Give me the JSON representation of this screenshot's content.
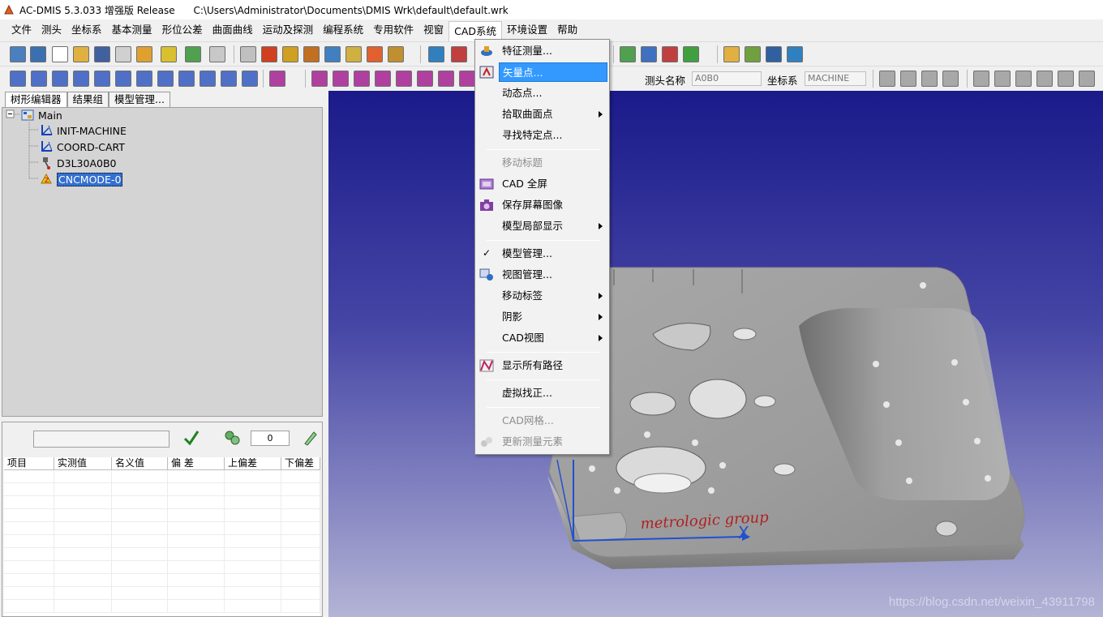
{
  "window": {
    "title": "AC-DMIS 5.3.033 增强版 Release      C:\\Users\\Administrator\\Documents\\DMIS Wrk\\default\\default.wrk"
  },
  "menubar": {
    "items": [
      "文件",
      "测头",
      "坐标系",
      "基本测量",
      "形位公差",
      "曲面曲线",
      "运动及探测",
      "编程系统",
      "专用软件",
      "视窗",
      "CAD系统",
      "环境设置",
      "帮助"
    ],
    "active_index": 10
  },
  "toolbar2": {
    "probe_label": "测头名称",
    "probe_value": "A0B0",
    "coord_label": "坐标系",
    "coord_value": "MACHINE"
  },
  "tabs": [
    "树形编辑器",
    "结果组",
    "模型管理..."
  ],
  "tree": {
    "root": "Main",
    "nodes": [
      {
        "label": "INIT-MACHINE",
        "icon": "coordinate-icon"
      },
      {
        "label": "COORD-CART",
        "icon": "coordinate-icon"
      },
      {
        "label": "D3L30A0B0",
        "icon": "probe-icon"
      },
      {
        "label": "CNCMODE-0",
        "icon": "cnc-mode-icon",
        "selected": true
      }
    ]
  },
  "report": {
    "count": "0",
    "columns": [
      "项目",
      "实测值",
      "名义值",
      "偏 差",
      "上偏差",
      "下偏差"
    ]
  },
  "dropdown": {
    "items": [
      {
        "label": "特征测量...",
        "icon": "feature-measure-icon"
      },
      {
        "label": "矢量点...",
        "icon": "vector-point-icon",
        "highlighted": true
      },
      {
        "label": "动态点..."
      },
      {
        "label": "拾取曲面点",
        "submenu": true
      },
      {
        "label": "寻找特定点..."
      },
      {
        "label": "移动标题",
        "disabled": true
      },
      {
        "label": "CAD 全屏",
        "icon": "fullscreen-icon"
      },
      {
        "label": "保存屏幕图像",
        "icon": "camera-icon"
      },
      {
        "label": "模型局部显示",
        "submenu": true
      },
      {
        "label": "模型管理...",
        "checked": true
      },
      {
        "label": "视图管理...",
        "icon": "view-manage-icon"
      },
      {
        "label": "移动标签",
        "submenu": true
      },
      {
        "label": "阴影",
        "submenu": true
      },
      {
        "label": "CAD视图",
        "submenu": true
      },
      {
        "label": "显示所有路径",
        "icon": "path-icon"
      },
      {
        "label": "虚拟找正..."
      },
      {
        "label": "CAD网格...",
        "disabled": true
      },
      {
        "label": "更新测量元素",
        "icon": "update-icon",
        "disabled": true
      }
    ]
  },
  "cad": {
    "part_text": "metrologic group",
    "axis_x_label": "X"
  },
  "watermark": "https://blog.csdn.net/weixin_43911798"
}
